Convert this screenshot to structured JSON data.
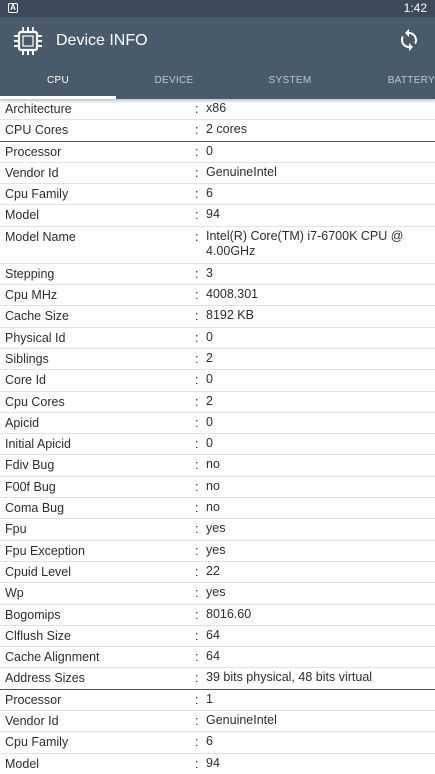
{
  "statusbar": {
    "time": "1:42",
    "app_icon": "A"
  },
  "appbar": {
    "title": "Device INFO",
    "icons": [
      "cpu-chip-icon",
      "refresh-icon"
    ]
  },
  "tabs": [
    {
      "label": "CPU",
      "active": true
    },
    {
      "label": "DEVICE",
      "active": false
    },
    {
      "label": "SYSTEM",
      "active": false
    },
    {
      "label": "BATTERY",
      "active": false
    }
  ],
  "rows": [
    {
      "label": "Architecture",
      "value": "x86"
    },
    {
      "label": "CPU Cores",
      "value": "2 cores"
    },
    {
      "label": "Processor",
      "value": "0"
    },
    {
      "label": "Vendor Id",
      "value": "GenuineIntel"
    },
    {
      "label": "Cpu Family",
      "value": "6"
    },
    {
      "label": "Model",
      "value": "94"
    },
    {
      "label": "Model Name",
      "value": "Intel(R) Core(TM) i7-6700K CPU @ 4.00GHz"
    },
    {
      "label": "Stepping",
      "value": "3"
    },
    {
      "label": "Cpu MHz",
      "value": "4008.301"
    },
    {
      "label": "Cache Size",
      "value": "8192 KB"
    },
    {
      "label": "Physical Id",
      "value": "0"
    },
    {
      "label": "Siblings",
      "value": "2"
    },
    {
      "label": "Core Id",
      "value": "0"
    },
    {
      "label": "Cpu Cores",
      "value": "2"
    },
    {
      "label": "Apicid",
      "value": "0"
    },
    {
      "label": "Initial Apicid",
      "value": "0"
    },
    {
      "label": "Fdiv Bug",
      "value": "no"
    },
    {
      "label": "F00f Bug",
      "value": "no"
    },
    {
      "label": "Coma Bug",
      "value": "no"
    },
    {
      "label": "Fpu",
      "value": "yes"
    },
    {
      "label": "Fpu Exception",
      "value": "yes"
    },
    {
      "label": "Cpuid Level",
      "value": "22"
    },
    {
      "label": "Wp",
      "value": "yes"
    },
    {
      "label": "Bogomips",
      "value": "8016.60"
    },
    {
      "label": "Clflush Size",
      "value": "64"
    },
    {
      "label": "Cache Alignment",
      "value": "64"
    },
    {
      "label": "Address Sizes",
      "value": "39 bits physical, 48 bits virtual"
    },
    {
      "label": "Processor",
      "value": "1"
    },
    {
      "label": "Vendor Id",
      "value": "GenuineIntel"
    },
    {
      "label": "Cpu Family",
      "value": "6"
    },
    {
      "label": "Model",
      "value": "94"
    }
  ],
  "separator": ":",
  "colors": {
    "appbar": "#495a6b",
    "statusbar": "#3c4a59",
    "text": "#2e2e2e"
  }
}
